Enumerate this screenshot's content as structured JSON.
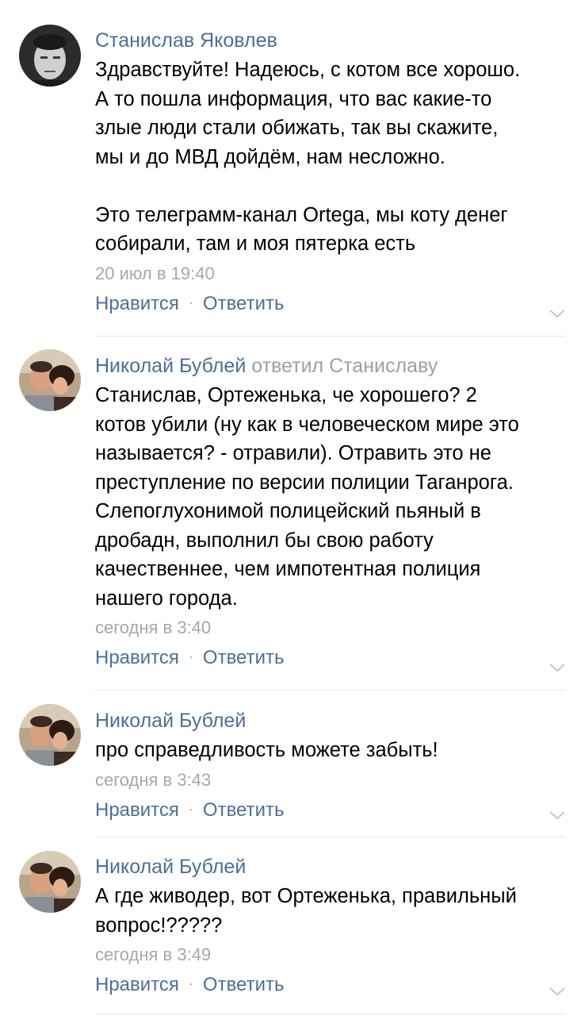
{
  "comments": [
    {
      "author": "Станислав Яковлев",
      "reply_to": "",
      "avatar": "avatar-man-dark-photo",
      "text": "Здравствуйте! Надеюсь, с котом все хорошо.\nА то пошла информация, что вас какие-то\nзлые люди стали обижать, так вы скажите,\nмы и до МВД дойдём, нам несложно.\n\nЭто телеграмм-канал Ortega, мы коту денег\nсобирали, там и моя пятерка есть",
      "time": "20 июл в 19:40",
      "like_label": "Нравится",
      "reply_label": "Ответить"
    },
    {
      "author": "Николай Бублей",
      "reply_to": "ответил Станиславу",
      "avatar": "avatar-couple-photo",
      "text": "Станислав, Ортеженька, че хорошего? 2\nкотов убили (ну как в человеческом мире это\nназывается? - отравили). Отравить это не\nпреступление по версии полиции Таганрога.\nСлепоглухонимой полицейский пьяный в\nдробадн, выполнил бы свою работу\nкачественнее, чем импотентная полиция\nнашего города.",
      "time": "сегодня в 3:40",
      "like_label": "Нравится",
      "reply_label": "Ответить"
    },
    {
      "author": "Николай Бублей",
      "reply_to": "",
      "avatar": "avatar-couple-photo",
      "text": "про справедливость можете забыть!",
      "time": "сегодня в 3:43",
      "like_label": "Нравится",
      "reply_label": "Ответить"
    },
    {
      "author": "Николай Бублей",
      "reply_to": "",
      "avatar": "avatar-couple-photo",
      "text": "А где живодер, вот Ортеженька, правильный\nвопрос!?????",
      "time": "сегодня в 3:49",
      "like_label": "Нравится",
      "reply_label": "Ответить"
    }
  ],
  "separator_glyph": "·",
  "colors": {
    "link": "#4a6f9c",
    "meta": "#a3a8ae",
    "text": "#000000",
    "divider": "#e3e5e8"
  }
}
